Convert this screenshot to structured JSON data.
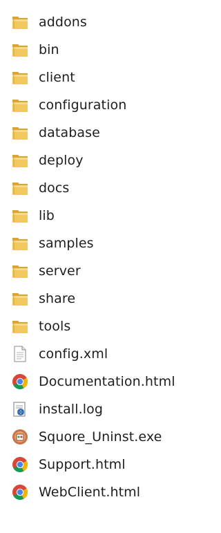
{
  "items": [
    {
      "label": "addons",
      "type": "folder",
      "icon": "folder-icon"
    },
    {
      "label": "bin",
      "type": "folder",
      "icon": "folder-icon"
    },
    {
      "label": "client",
      "type": "folder",
      "icon": "folder-icon"
    },
    {
      "label": "configuration",
      "type": "folder",
      "icon": "folder-icon"
    },
    {
      "label": "database",
      "type": "folder",
      "icon": "folder-icon"
    },
    {
      "label": "deploy",
      "type": "folder",
      "icon": "folder-icon"
    },
    {
      "label": "docs",
      "type": "folder",
      "icon": "folder-icon"
    },
    {
      "label": "lib",
      "type": "folder",
      "icon": "folder-icon"
    },
    {
      "label": "samples",
      "type": "folder",
      "icon": "folder-icon"
    },
    {
      "label": "server",
      "type": "folder",
      "icon": "folder-icon"
    },
    {
      "label": "share",
      "type": "folder",
      "icon": "folder-icon"
    },
    {
      "label": "tools",
      "type": "folder",
      "icon": "folder-icon"
    },
    {
      "label": "config.xml",
      "type": "xml",
      "icon": "document-icon"
    },
    {
      "label": "Documentation.html",
      "type": "html",
      "icon": "chrome-icon"
    },
    {
      "label": "install.log",
      "type": "log",
      "icon": "log-file-icon"
    },
    {
      "label": "Squore_Uninst.exe",
      "type": "exe",
      "icon": "installer-icon"
    },
    {
      "label": "Support.html",
      "type": "html",
      "icon": "chrome-icon"
    },
    {
      "label": "WebClient.html",
      "type": "html",
      "icon": "chrome-icon"
    }
  ],
  "colors": {
    "folder": "#e8b84a",
    "text": "#1e1e1e",
    "chrome_red": "#db4437",
    "chrome_yellow": "#f4b400",
    "chrome_green": "#0f9d58",
    "chrome_blue": "#4285f4"
  }
}
